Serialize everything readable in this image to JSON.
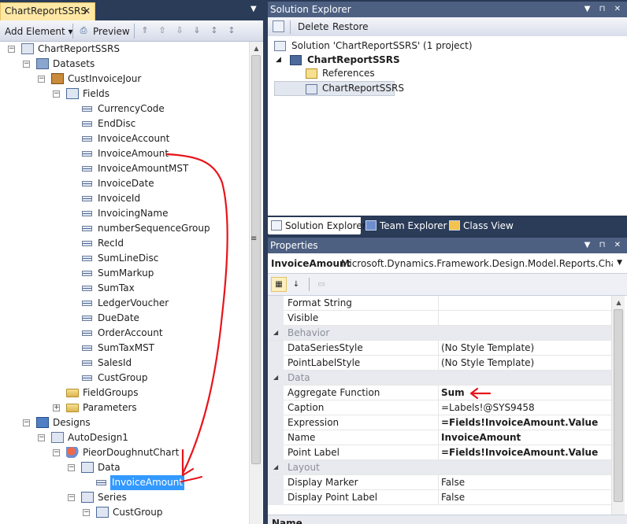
{
  "document_tab": {
    "title": "ChartReportSSRS",
    "close": "✕"
  },
  "left_toolbar": {
    "add_element": "Add Element ▾",
    "preview": "Preview"
  },
  "tree": {
    "root": "ChartReportSSRS",
    "datasets": "Datasets",
    "dataset": "CustInvoiceJour",
    "fields_folder": "Fields",
    "fields": [
      "CurrencyCode",
      "EndDisc",
      "InvoiceAccount",
      "InvoiceAmount",
      "InvoiceAmountMST",
      "InvoiceDate",
      "InvoiceId",
      "InvoicingName",
      "numberSequenceGroup",
      "RecId",
      "SumLineDisc",
      "SumMarkup",
      "SumTax",
      "LedgerVoucher",
      "DueDate",
      "OrderAccount",
      "SumTaxMST",
      "SalesId",
      "CustGroup"
    ],
    "field_groups": "FieldGroups",
    "parameters": "Parameters",
    "designs": "Designs",
    "auto_design": "AutoDesign1",
    "chart": "PieorDoughnutChart",
    "data_node": "Data",
    "selected_item": "InvoiceAmount",
    "series": "Series",
    "series_group": "CustGroup"
  },
  "solution_explorer": {
    "title": "Solution Explorer",
    "toolbar": {
      "delete": "Delete",
      "restore": "Restore"
    },
    "solution": "Solution 'ChartReportSSRS' (1 project)",
    "project": "ChartReportSSRS",
    "references": "References",
    "item": "ChartReportSSRS",
    "tabs": [
      "Solution Explorer",
      "Team Explorer",
      "Class View"
    ]
  },
  "properties": {
    "title": "Properties",
    "object_name": "InvoiceAmount",
    "object_type": "Microsoft.Dynamics.Framework.Design.Model.Reports.ChartData",
    "rows": [
      {
        "kind": "prop",
        "name": "Format String",
        "value": ""
      },
      {
        "kind": "prop",
        "name": "Visible",
        "value": ""
      },
      {
        "kind": "cat",
        "name": "Behavior"
      },
      {
        "kind": "prop",
        "name": "DataSeriesStyle",
        "value": "(No Style Template)"
      },
      {
        "kind": "prop",
        "name": "PointLabelStyle",
        "value": "(No Style Template)"
      },
      {
        "kind": "cat",
        "name": "Data"
      },
      {
        "kind": "prop",
        "name": "Aggregate Function",
        "value": "Sum",
        "bold": true
      },
      {
        "kind": "prop",
        "name": "Caption",
        "value": "=Labels!@SYS9458"
      },
      {
        "kind": "prop",
        "name": "Expression",
        "value": "=Fields!InvoiceAmount.Value",
        "bold": true
      },
      {
        "kind": "prop",
        "name": "Name",
        "value": "InvoiceAmount",
        "bold": true
      },
      {
        "kind": "prop",
        "name": "Point Label",
        "value": "=Fields!InvoiceAmount.Value",
        "bold": true
      },
      {
        "kind": "cat",
        "name": "Layout"
      },
      {
        "kind": "prop",
        "name": "Display Marker",
        "value": "False"
      },
      {
        "kind": "prop",
        "name": "Display Point Label",
        "value": "False"
      }
    ],
    "description_title": "Name"
  },
  "colors": {
    "annotation": "#e8141b",
    "selection": "#3399ff",
    "tab_active": "#ffe8a6",
    "chrome": "#2b3c59"
  }
}
